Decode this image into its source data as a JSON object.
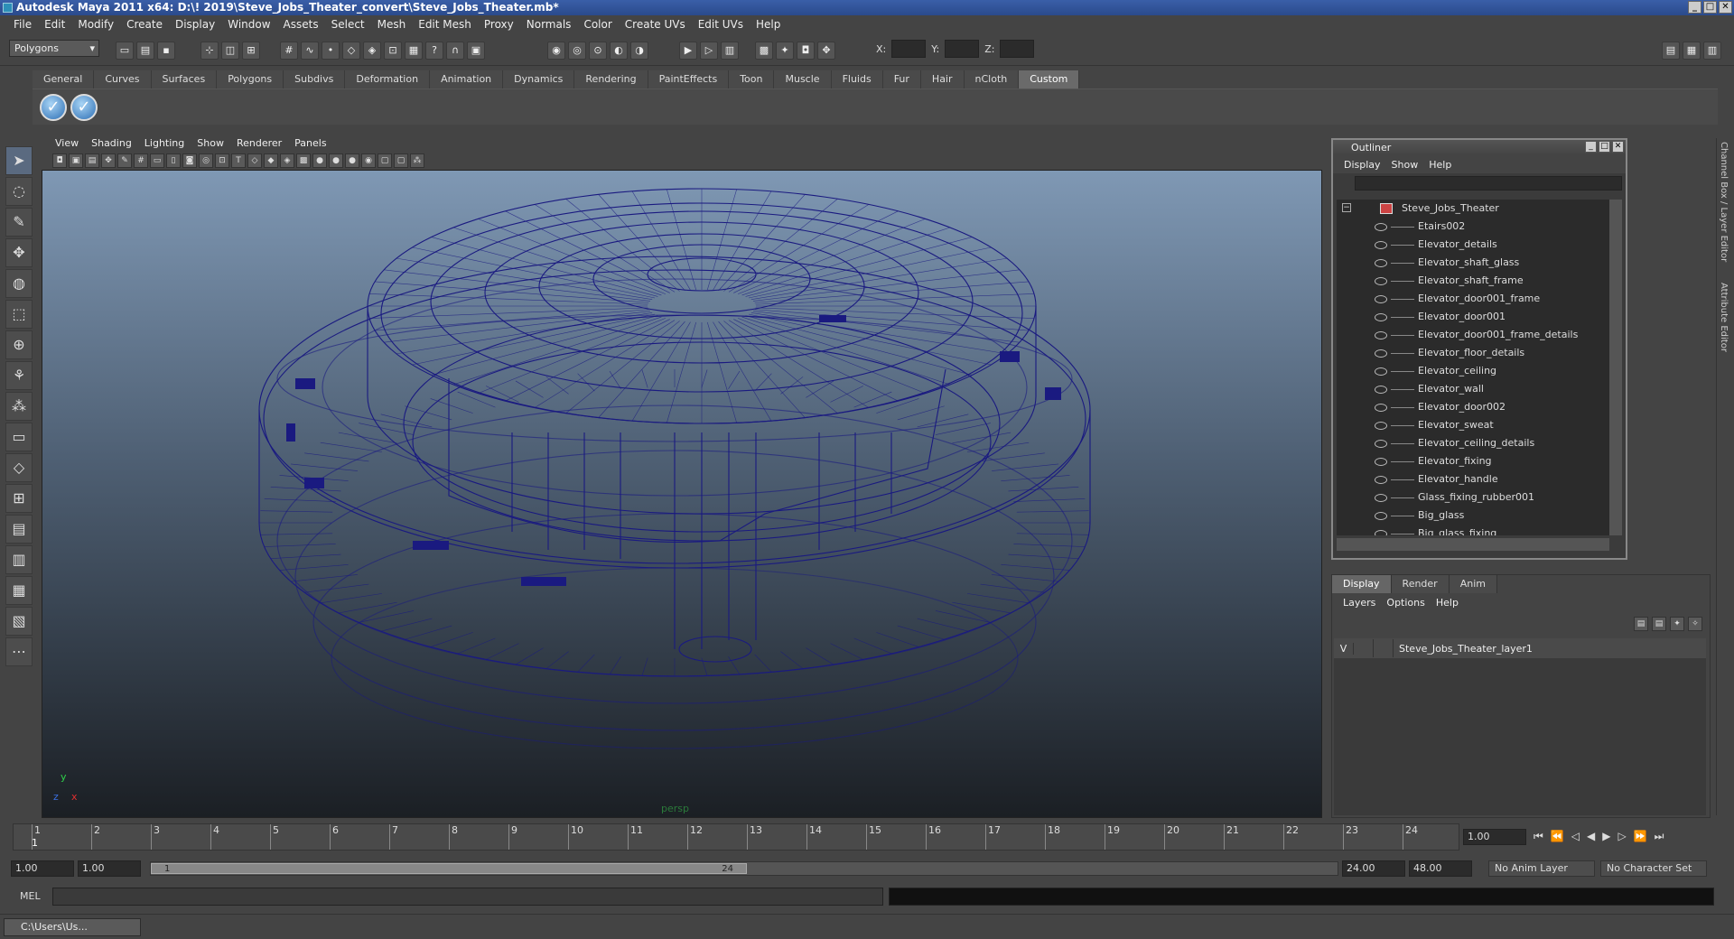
{
  "window": {
    "title": "Autodesk Maya 2011 x64: D:\\! 2019\\Steve_Jobs_Theater_convert\\Steve_Jobs_Theater.mb*"
  },
  "menus": [
    "File",
    "Edit",
    "Modify",
    "Create",
    "Display",
    "Window",
    "Assets",
    "Select",
    "Mesh",
    "Edit Mesh",
    "Proxy",
    "Normals",
    "Color",
    "Create UVs",
    "Edit UVs",
    "Help"
  ],
  "status": {
    "mode": "Polygons",
    "x_label": "X:",
    "y_label": "Y:",
    "z_label": "Z:"
  },
  "shelf_tabs": [
    "General",
    "Curves",
    "Surfaces",
    "Polygons",
    "Subdivs",
    "Deformation",
    "Animation",
    "Dynamics",
    "Rendering",
    "PaintEffects",
    "Toon",
    "Muscle",
    "Fluids",
    "Fur",
    "Hair",
    "nCloth",
    "Custom"
  ],
  "shelf_active": "Custom",
  "viewport": {
    "menus": [
      "View",
      "Shading",
      "Lighting",
      "Show",
      "Renderer",
      "Panels"
    ],
    "camera": "persp",
    "axis_y": "y",
    "axis_x": "x",
    "axis_z": "z"
  },
  "outliner": {
    "title": "Outliner",
    "menus": [
      "Display",
      "Show",
      "Help"
    ],
    "root": "Steve_Jobs_Theater",
    "items": [
      "Etairs002",
      "Elevator_details",
      "Elevator_shaft_glass",
      "Elevator_shaft_frame",
      "Elevator_door001_frame",
      "Elevator_door001",
      "Elevator_door001_frame_details",
      "Elevator_floor_details",
      "Elevator_ceiling",
      "Elevator_wall",
      "Elevator_door002",
      "Elevator_sweat",
      "Elevator_ceiling_details",
      "Elevator_fixing",
      "Elevator_handle",
      "Glass_fixing_rubber001",
      "Big_glass",
      "Big_glass_fixing"
    ]
  },
  "layers": {
    "tabs": [
      "Display",
      "Render",
      "Anim"
    ],
    "menus": [
      "Layers",
      "Options",
      "Help"
    ],
    "rows": [
      {
        "visible": "V",
        "name": "Steve_Jobs_Theater_layer1"
      }
    ]
  },
  "side_tabs": [
    "Channel Box / Layer Editor",
    "Attribute Editor"
  ],
  "timeline": {
    "ticks": [
      "1",
      "2",
      "3",
      "4",
      "5",
      "6",
      "7",
      "8",
      "9",
      "10",
      "11",
      "12",
      "13",
      "14",
      "15",
      "16",
      "17",
      "18",
      "19",
      "20",
      "21",
      "22",
      "23",
      "24"
    ],
    "current_marker": "1",
    "current_frame": "1.00"
  },
  "range": {
    "start": "1.00",
    "inner_start": "1.00",
    "slider_start": "1",
    "slider_end": "24",
    "end": "24.00",
    "outer_end": "48.00",
    "anim_layer": "No Anim Layer",
    "char_set": "No Character Set"
  },
  "command": {
    "label": "MEL"
  },
  "taskbar": {
    "item": "C:\\Users\\Us..."
  }
}
